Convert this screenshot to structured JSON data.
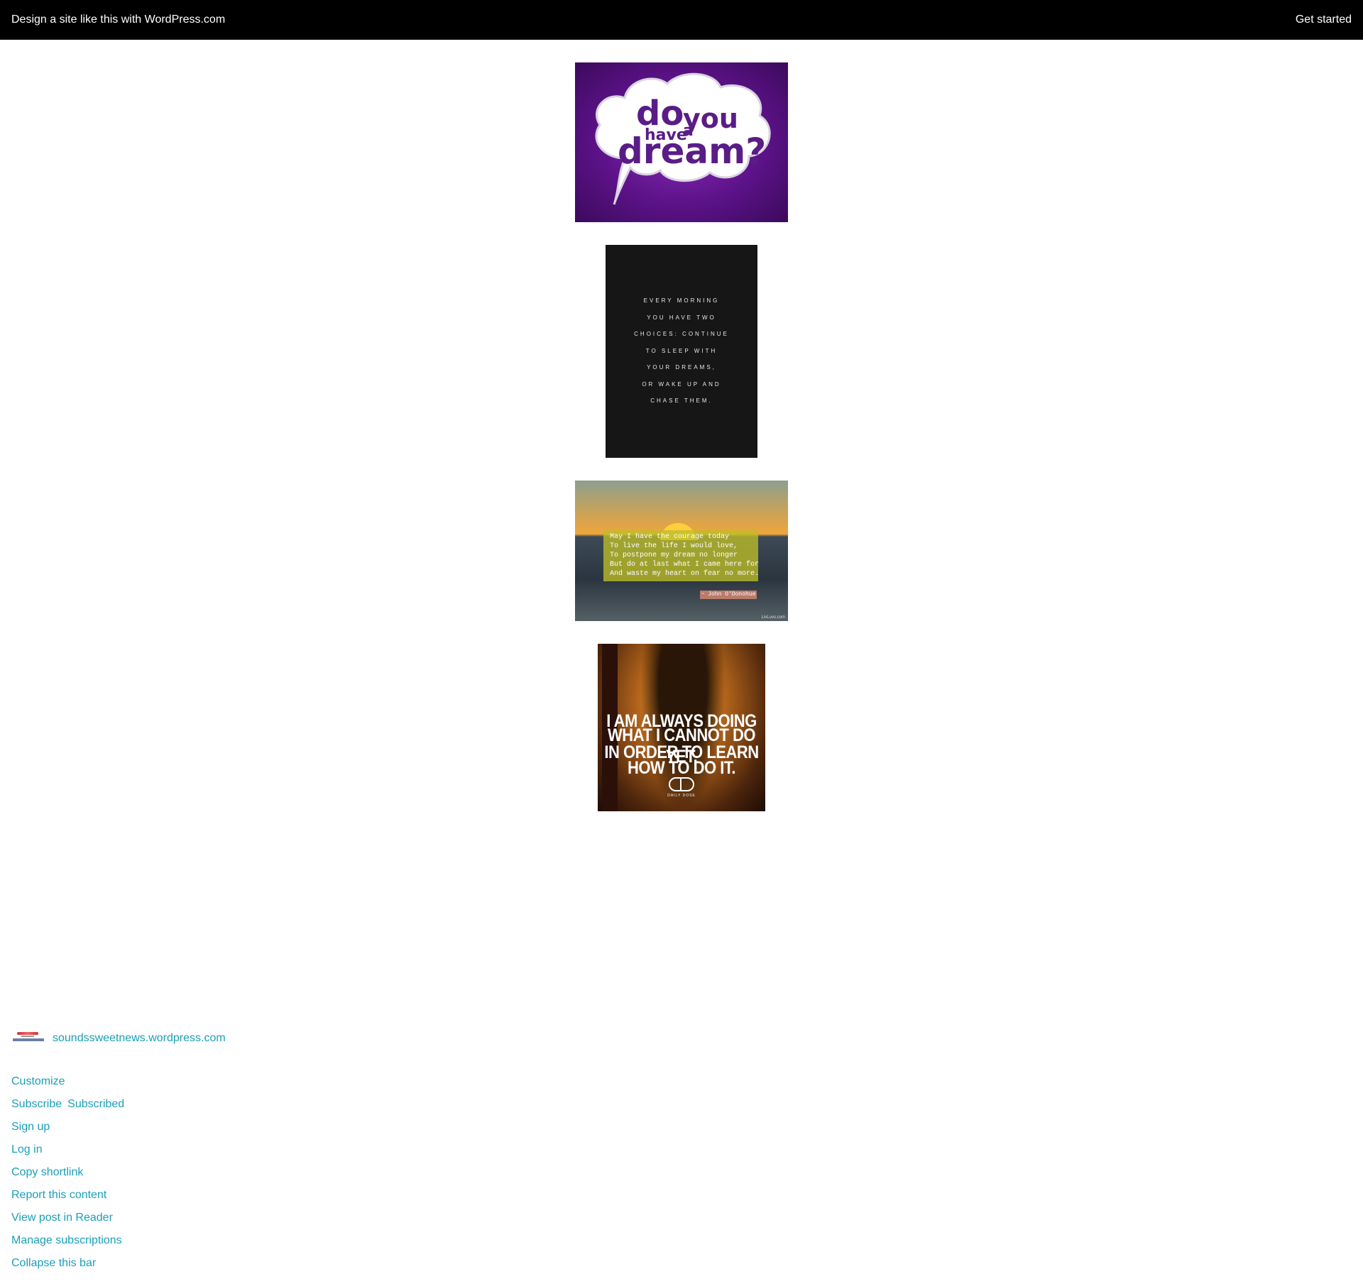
{
  "topbar": {
    "cta_text": "Design a site like this with WordPress.com",
    "get_started": "Get started"
  },
  "images": {
    "dream": {
      "word_do": "do",
      "word_you": "you",
      "word_have": "have",
      "word_a": "a",
      "word_dream": "dream?"
    },
    "morning": {
      "lines": [
        "EVERY MORNING",
        "YOU HAVE TWO",
        "CHOICES: CONTINUE",
        "TO SLEEP WITH",
        "YOUR DREAMS,",
        "OR WAKE UP AND",
        "CHASE THEM."
      ]
    },
    "sunset": {
      "lines": [
        "May I have the courage today",
        "To live the life I would love,",
        "To postpone my dream no longer",
        "But do at last what I came here for",
        "And waste my heart on fear no more."
      ],
      "author": "~ John O'Donohue",
      "watermark": "LivLuvs.com"
    },
    "always": {
      "lines": [
        "I AM ALWAYS DOING",
        "WHAT I CANNOT DO YET,",
        "IN ORDER TO LEARN",
        "HOW TO DO IT."
      ],
      "logo_text": "DAILY DOSE"
    }
  },
  "footer": {
    "site_name": "soundssweetnews.wordpress.com",
    "customize": "Customize",
    "subscribe": "Subscribe",
    "subscribed": "Subscribed",
    "sign_up": "Sign up",
    "log_in": "Log in",
    "copy_shortlink": "Copy shortlink",
    "report": "Report this content",
    "view_reader": "View post in Reader",
    "manage_subs": "Manage subscriptions",
    "collapse": "Collapse this bar"
  },
  "colors": {
    "link": "#1a9fb8",
    "topbar_bg": "#000000"
  }
}
